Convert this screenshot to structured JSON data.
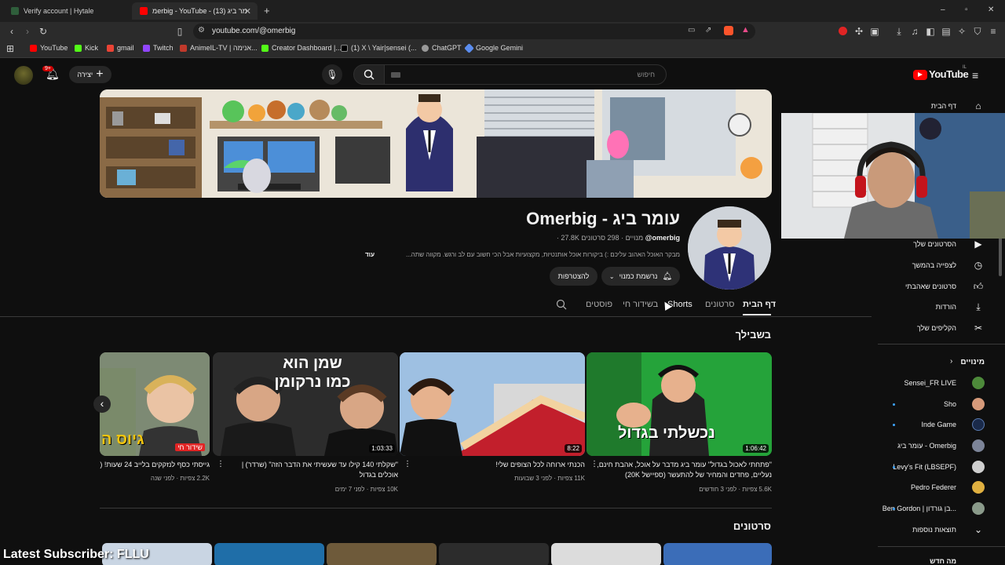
{
  "browser": {
    "tabs": [
      {
        "title": "Verify account | Hytale",
        "active": false
      },
      {
        "title": "מerbig - YouTube - עומר ביג (13)",
        "active": true
      }
    ],
    "new_tab": "+",
    "url": "youtube.com/@omerbig",
    "window_controls": [
      "–",
      "▫",
      "✕"
    ],
    "bookmarks": [
      "YouTube",
      "Kick",
      "gmail",
      "Twitch",
      "AnimeIL-TV | אנימה...",
      "Creator Dashboard |...",
      "(1) X \\ Yair|sensei (...",
      "ChatGPT",
      "Google Gemini"
    ]
  },
  "youtube": {
    "logo": "YouTube",
    "logo_region": "IL",
    "search_placeholder": "חיפוש",
    "create_label": "יצירה",
    "notif_count": "9+",
    "channel": {
      "name": "Omerbig - עומר ביג",
      "handle": "@omerbig",
      "stats": "· 27.8K מנויים · 298 סרטונים",
      "description": "מבקר האוכל האהוב עליכם :) ביקורות אוכל אותנטיות, מקצועיות אבל הכי חשוב עם לב ורגש. מקווה שתה...",
      "more": "עוד",
      "subscribed_label": "נרשמת כמנוי",
      "join_label": "להצטרפות"
    },
    "tabs": [
      "דף הבית",
      "סרטונים",
      "Shorts",
      "בשידור חי",
      "פוסטים"
    ],
    "section_for_you": "בשבילך",
    "section_videos": "סרטונים",
    "videos": [
      {
        "title": "\"פתחתי לאכול בגדול\" עומר ביג מדבר על אוכל, אהבת חינם, נעליים, פחדים והמחיר של להתעשר (ספיישל 20K)",
        "meta": "5.6K צפיות · לפני 3 חודשים",
        "duration": "1:06:42",
        "thumb_text": "נכשלתי בגדול"
      },
      {
        "title": "הכנתי ארוחה לכל הצופים שלי!",
        "meta": "11K צפיות · לפני 3 שבועות",
        "duration": "8:22",
        "thumb_text": ""
      },
      {
        "title": "\"שקלתי 140 קילו עד שעשיתי את הדבר הזה\" (שרדר) | אוכלים בגדול",
        "meta": "10K צפיות · לפני 7 ימים",
        "duration": "1:03:33",
        "thumb_text": "שמן הוא כמו נרקומן"
      },
      {
        "title": "גייסתי כסף לנזקקים בלייב 24 שעות! (כ",
        "meta": "2.2K צפיות · לפני שנה",
        "duration": "שידור חי",
        "thumb_text": "גיוס ה"
      }
    ],
    "sidebar": {
      "home": "דף הבית",
      "items": [
        "הסרטונים שלך",
        "לצפייה בהמשך",
        "סרטונים שאהבתי",
        "הורדות",
        "הקליפים שלך"
      ],
      "subscriptions_header": "מינויים",
      "subscriptions": [
        "Sensei_FR LIVE",
        "Sho",
        "Inde Game",
        "Omerbig - עומר ביג",
        "Levy's Fit (LBSEPF)",
        "Pedro Federer",
        "Ben Gordon | בן גורדון..."
      ],
      "show_more": "תוצאות נוספות",
      "explore": "מה חדש"
    }
  },
  "overlay": {
    "latest_subscriber": "Latest Subscriber: FLLU"
  },
  "colors": {
    "bg": "#0f0f0f",
    "accent_red": "#ff0000",
    "text_secondary": "#aaaaaa"
  }
}
